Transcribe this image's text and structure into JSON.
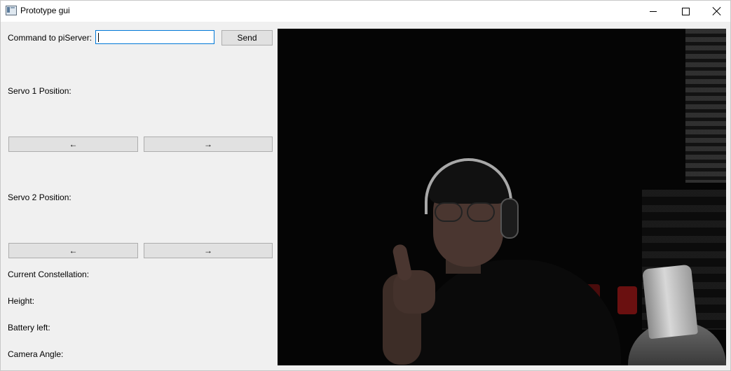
{
  "window": {
    "title": "Prototype gui"
  },
  "command": {
    "label": "Command to piServer:",
    "value": "",
    "send_label": "Send"
  },
  "servo1": {
    "label": "Servo 1 Position:",
    "left_label": "←",
    "right_label": "→"
  },
  "servo2": {
    "label": "Servo 2 Position:",
    "left_label": "←",
    "right_label": "→"
  },
  "status": {
    "constellation_label": "Current Constellation:",
    "height_label": "Height:",
    "battery_label": "Battery left:",
    "camera_angle_label": "Camera Angle:"
  },
  "icons": {
    "app": "window-app-icon",
    "minimize": "minimize-icon",
    "maximize": "maximize-icon",
    "close": "close-icon"
  },
  "colors": {
    "window_bg": "#f0f0f0",
    "titlebar_bg": "#ffffff",
    "input_focus_border": "#0078d7",
    "button_bg": "#e1e1e1",
    "button_border": "#adadad",
    "video_bg": "#050505"
  }
}
